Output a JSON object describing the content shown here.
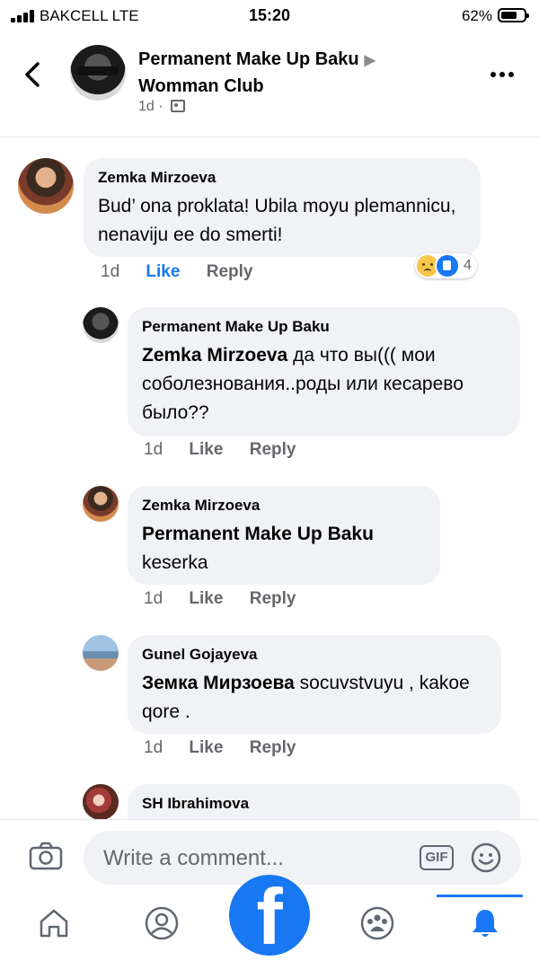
{
  "status_bar": {
    "carrier": "BAKCELL  LTE",
    "time": "15:20",
    "battery": "62%",
    "battery_level": 0.62
  },
  "header": {
    "title": "Permanent Make Up Baku ▶ Womman Club",
    "title_line1": "Permanent Make Up Baku",
    "title_line2": "Womman Club",
    "time": "1d ·"
  },
  "comments": [
    {
      "author": "Zemka  Mirzoeva",
      "text": "Bud’ ona proklata! Ubila moyu plemannicu, nenaviju ee do smerti!",
      "time": "1d",
      "like": "Like",
      "reply": "Reply",
      "reaction_count": "4"
    },
    {
      "author": "Permanent Make Up Baku",
      "mention": "Zemka  Mirzoeva",
      "text": "да что вы((( мои соболезнования..роды или кесарево было??",
      "time": "1d",
      "like": "Like",
      "reply": "Reply"
    },
    {
      "author": "Zemka  Mirzoeva",
      "mention": "Permanent Make Up Baku",
      "text": "keserka",
      "time": "1d",
      "like": "Like",
      "reply": "Reply"
    },
    {
      "author": "Gunel Gojayeva",
      "mention": "Земка Мирзоева",
      "text": "socuvstvuyu , kakoe qore .",
      "time": "1d",
      "like": "Like",
      "reply": "Reply"
    },
    {
      "author": "SH Ibrahimova"
    }
  ],
  "composer": {
    "placeholder": "Write a comment...",
    "gif": "GIF"
  },
  "tabbar": {
    "tabs": [
      {
        "icon": "home-icon"
      },
      {
        "icon": "profile-icon"
      },
      {
        "icon": "facebook-icon"
      },
      {
        "icon": "groups-icon"
      },
      {
        "icon": "notifications-icon"
      }
    ],
    "active": "notifications-icon",
    "accent": "#1877f2"
  },
  "colors": {
    "bubble": "#f0f2f5",
    "secondary_text": "#65676b",
    "accent": "#1877f2"
  }
}
